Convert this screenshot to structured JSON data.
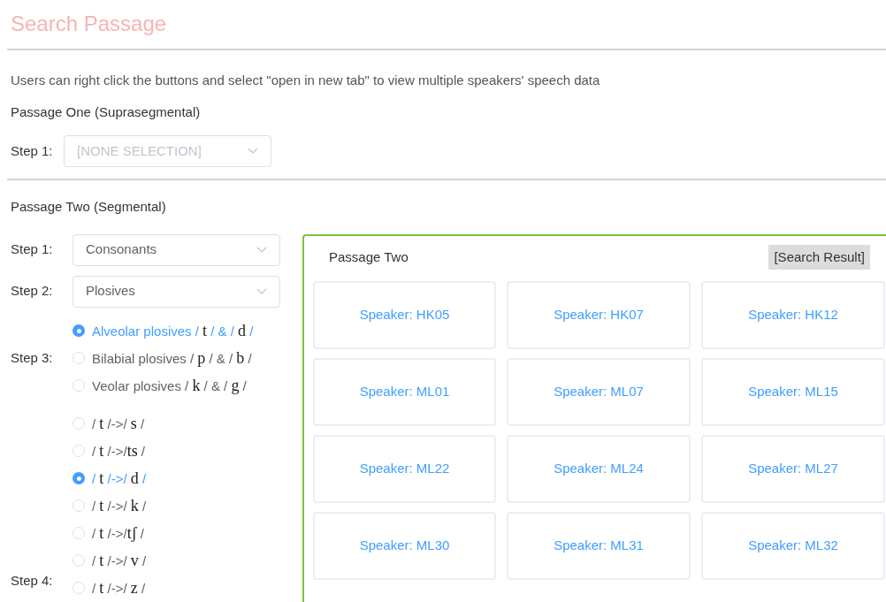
{
  "title": "Search Passage",
  "notice": "Users can right click the buttons and select \"open in new tab\" to view multiple speakers' speech data",
  "passage_one": {
    "heading": "Passage One (Suprasegmental)",
    "steps": [
      {
        "label": "Step 1:",
        "value": "[NONE SELECTION]",
        "disabled": true
      }
    ]
  },
  "passage_two": {
    "heading": "Passage Two (Segmental)",
    "steps": [
      {
        "label": "Step 1:",
        "value": "Consonants",
        "disabled": false
      },
      {
        "label": "Step 2:",
        "value": "Plosives",
        "disabled": false
      }
    ],
    "step3": {
      "label": "Step 3:",
      "options": [
        {
          "selected": true,
          "parts": [
            {
              "kind": "plain",
              "text": "Alveolar plosives / "
            },
            {
              "kind": "ipa",
              "text": "t"
            },
            {
              "kind": "plain",
              "text": " / & / "
            },
            {
              "kind": "ipa",
              "text": "d"
            },
            {
              "kind": "plain",
              "text": " /"
            }
          ]
        },
        {
          "selected": false,
          "parts": [
            {
              "kind": "plain",
              "text": "Bilabial plosives / "
            },
            {
              "kind": "ipa",
              "text": "p"
            },
            {
              "kind": "plain",
              "text": " / & / "
            },
            {
              "kind": "ipa",
              "text": "b"
            },
            {
              "kind": "plain",
              "text": " /"
            }
          ]
        },
        {
          "selected": false,
          "parts": [
            {
              "kind": "plain",
              "text": "Veolar plosives / "
            },
            {
              "kind": "ipa",
              "text": "k"
            },
            {
              "kind": "plain",
              "text": " / & / "
            },
            {
              "kind": "ipa",
              "text": "g"
            },
            {
              "kind": "plain",
              "text": " /"
            }
          ]
        }
      ]
    },
    "step4": {
      "label": "Step 4:",
      "options": [
        {
          "selected": false,
          "parts": [
            {
              "kind": "plain",
              "text": "/ "
            },
            {
              "kind": "ipa",
              "text": "t"
            },
            {
              "kind": "plain",
              "text": " /->/ "
            },
            {
              "kind": "ipa",
              "text": "s"
            },
            {
              "kind": "plain",
              "text": " /"
            }
          ]
        },
        {
          "selected": false,
          "parts": [
            {
              "kind": "plain",
              "text": "/ "
            },
            {
              "kind": "ipa",
              "text": "t"
            },
            {
              "kind": "plain",
              "text": " /->/"
            },
            {
              "kind": "ipa",
              "text": "ts"
            },
            {
              "kind": "plain",
              "text": " /"
            }
          ]
        },
        {
          "selected": true,
          "parts": [
            {
              "kind": "plain",
              "text": "/ "
            },
            {
              "kind": "ipa",
              "text": "t"
            },
            {
              "kind": "plain",
              "text": " /->/ "
            },
            {
              "kind": "ipa",
              "text": "d"
            },
            {
              "kind": "plain",
              "text": " /"
            }
          ]
        },
        {
          "selected": false,
          "parts": [
            {
              "kind": "plain",
              "text": "/ "
            },
            {
              "kind": "ipa",
              "text": "t"
            },
            {
              "kind": "plain",
              "text": " /->/ "
            },
            {
              "kind": "ipa",
              "text": "k"
            },
            {
              "kind": "plain",
              "text": " /"
            }
          ]
        },
        {
          "selected": false,
          "parts": [
            {
              "kind": "plain",
              "text": "/ "
            },
            {
              "kind": "ipa",
              "text": "t"
            },
            {
              "kind": "plain",
              "text": " /->/"
            },
            {
              "kind": "ipa",
              "text": "tʃ"
            },
            {
              "kind": "plain",
              "text": " /"
            }
          ]
        },
        {
          "selected": false,
          "parts": [
            {
              "kind": "plain",
              "text": "/ "
            },
            {
              "kind": "ipa",
              "text": "t"
            },
            {
              "kind": "plain",
              "text": " /->/ "
            },
            {
              "kind": "ipa",
              "text": "v"
            },
            {
              "kind": "plain",
              "text": " /"
            }
          ]
        },
        {
          "selected": false,
          "parts": [
            {
              "kind": "plain",
              "text": "/ "
            },
            {
              "kind": "ipa",
              "text": "t"
            },
            {
              "kind": "plain",
              "text": " /->/ "
            },
            {
              "kind": "ipa",
              "text": "z"
            },
            {
              "kind": "plain",
              "text": " /"
            }
          ]
        }
      ]
    },
    "results": {
      "heading": "Passage Two",
      "badge": "[Search Result]",
      "speakers": [
        "Speaker: HK05",
        "Speaker: HK07",
        "Speaker: HK12",
        "Speaker: ML01",
        "Speaker: ML07",
        "Speaker: ML15",
        "Speaker: ML22",
        "Speaker: ML24",
        "Speaker: ML27",
        "Speaker: ML30",
        "Speaker: ML31",
        "Speaker: ML32"
      ]
    }
  }
}
